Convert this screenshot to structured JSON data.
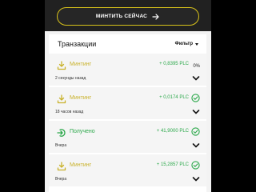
{
  "mint_button": {
    "label": "МИНТИТЬ СЕЙЧАС",
    "icon": "arrow-right-icon"
  },
  "transactions": {
    "title": "Транзакции",
    "filter_label": "Фильтр",
    "items": [
      {
        "type": "Минтинг",
        "amount": "+ 0,8395 PLC",
        "status": "0%",
        "time": "2 секунды назад",
        "icon": "download-icon"
      },
      {
        "type": "Минтинг",
        "amount": "+ 0,0174 PLC",
        "status": "done",
        "time": "18 часов назад",
        "icon": "download-icon"
      },
      {
        "type": "Получено",
        "amount": "+ 41,9000 PLC",
        "status": "done",
        "time": "Вчера",
        "icon": "receive-icon"
      },
      {
        "type": "Минтинг",
        "amount": "+ 15,2857 PLC",
        "status": "done",
        "time": "Вчера",
        "icon": "download-icon"
      }
    ]
  },
  "colors": {
    "accent_gold": "#d8c21a",
    "positive_green": "#2ba84a",
    "header_bg": "#212121"
  }
}
